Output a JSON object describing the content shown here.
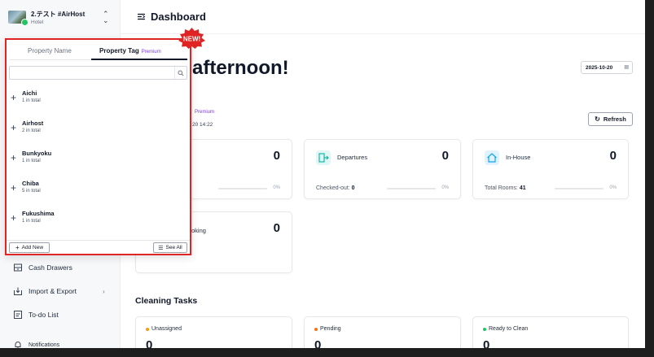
{
  "property": {
    "name": "2.テスト #AirHost",
    "type": "Hotel"
  },
  "header": {
    "title": "Dashboard"
  },
  "greeting": "afternoon!",
  "date": "2025-10-20",
  "premium_label": "Premium",
  "updated_text": "20 14:22",
  "refresh_label": "Refresh",
  "cards": {
    "arrivals": {
      "count": "0",
      "pct": "0%"
    },
    "departures": {
      "label": "Departures",
      "count": "0",
      "foot_label": "Checked-out:",
      "foot_value": "0",
      "pct": "0%"
    },
    "inhouse": {
      "label": "In-House",
      "count": "0",
      "foot_label": "Total Rooms:",
      "foot_value": "41",
      "pct": "0%"
    },
    "booking": {
      "label": "oking",
      "count": "0"
    }
  },
  "cleaning": {
    "title": "Cleaning Tasks",
    "tasks": [
      {
        "label": "Unassigned",
        "count": "0",
        "color": "#f59e0b"
      },
      {
        "label": "Pending",
        "count": "0",
        "color": "#f97316"
      },
      {
        "label": "Ready to Clean",
        "count": "0",
        "color": "#22c55e"
      }
    ]
  },
  "sidebar": {
    "items": [
      {
        "label": "Cash Drawers",
        "icon": "cash-drawer-icon"
      },
      {
        "label": "Import & Export",
        "icon": "import-export-icon"
      },
      {
        "label": "To-do List",
        "icon": "todo-icon"
      },
      {
        "label": "Notifications",
        "icon": "bell-icon"
      }
    ]
  },
  "panel": {
    "tabs": [
      {
        "label": "Property Name"
      },
      {
        "label": "Property Tag",
        "badge": "Premium"
      }
    ],
    "search_placeholder": "",
    "tags": [
      {
        "name": "Aichi",
        "count": "1 in total"
      },
      {
        "name": "Airhost",
        "count": "2 in total"
      },
      {
        "name": "Bunkyoku",
        "count": "1 in total"
      },
      {
        "name": "Chiba",
        "count": "5 in total"
      },
      {
        "name": "Fukushima",
        "count": "1 in total"
      }
    ],
    "add_new_label": "Add New",
    "see_all_label": "See All"
  },
  "new_badge": "NEW!",
  "colors": {
    "highlight": "#e02424",
    "accent_teal": "#14b8a6",
    "premium": "#7c3aed"
  }
}
